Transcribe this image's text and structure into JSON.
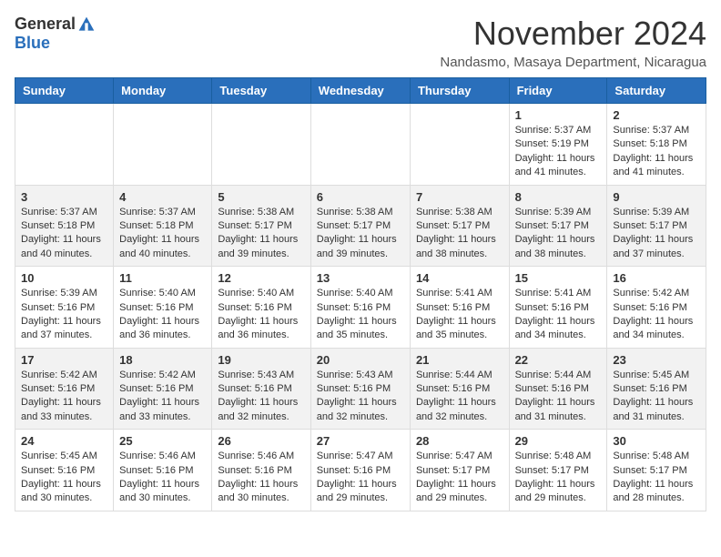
{
  "header": {
    "logo_general": "General",
    "logo_blue": "Blue",
    "month_title": "November 2024",
    "location": "Nandasmo, Masaya Department, Nicaragua"
  },
  "columns": [
    "Sunday",
    "Monday",
    "Tuesday",
    "Wednesday",
    "Thursday",
    "Friday",
    "Saturday"
  ],
  "weeks": [
    [
      {
        "day": "",
        "info": ""
      },
      {
        "day": "",
        "info": ""
      },
      {
        "day": "",
        "info": ""
      },
      {
        "day": "",
        "info": ""
      },
      {
        "day": "",
        "info": ""
      },
      {
        "day": "1",
        "info": "Sunrise: 5:37 AM\nSunset: 5:19 PM\nDaylight: 11 hours\nand 41 minutes."
      },
      {
        "day": "2",
        "info": "Sunrise: 5:37 AM\nSunset: 5:18 PM\nDaylight: 11 hours\nand 41 minutes."
      }
    ],
    [
      {
        "day": "3",
        "info": "Sunrise: 5:37 AM\nSunset: 5:18 PM\nDaylight: 11 hours\nand 40 minutes."
      },
      {
        "day": "4",
        "info": "Sunrise: 5:37 AM\nSunset: 5:18 PM\nDaylight: 11 hours\nand 40 minutes."
      },
      {
        "day": "5",
        "info": "Sunrise: 5:38 AM\nSunset: 5:17 PM\nDaylight: 11 hours\nand 39 minutes."
      },
      {
        "day": "6",
        "info": "Sunrise: 5:38 AM\nSunset: 5:17 PM\nDaylight: 11 hours\nand 39 minutes."
      },
      {
        "day": "7",
        "info": "Sunrise: 5:38 AM\nSunset: 5:17 PM\nDaylight: 11 hours\nand 38 minutes."
      },
      {
        "day": "8",
        "info": "Sunrise: 5:39 AM\nSunset: 5:17 PM\nDaylight: 11 hours\nand 38 minutes."
      },
      {
        "day": "9",
        "info": "Sunrise: 5:39 AM\nSunset: 5:17 PM\nDaylight: 11 hours\nand 37 minutes."
      }
    ],
    [
      {
        "day": "10",
        "info": "Sunrise: 5:39 AM\nSunset: 5:16 PM\nDaylight: 11 hours\nand 37 minutes."
      },
      {
        "day": "11",
        "info": "Sunrise: 5:40 AM\nSunset: 5:16 PM\nDaylight: 11 hours\nand 36 minutes."
      },
      {
        "day": "12",
        "info": "Sunrise: 5:40 AM\nSunset: 5:16 PM\nDaylight: 11 hours\nand 36 minutes."
      },
      {
        "day": "13",
        "info": "Sunrise: 5:40 AM\nSunset: 5:16 PM\nDaylight: 11 hours\nand 35 minutes."
      },
      {
        "day": "14",
        "info": "Sunrise: 5:41 AM\nSunset: 5:16 PM\nDaylight: 11 hours\nand 35 minutes."
      },
      {
        "day": "15",
        "info": "Sunrise: 5:41 AM\nSunset: 5:16 PM\nDaylight: 11 hours\nand 34 minutes."
      },
      {
        "day": "16",
        "info": "Sunrise: 5:42 AM\nSunset: 5:16 PM\nDaylight: 11 hours\nand 34 minutes."
      }
    ],
    [
      {
        "day": "17",
        "info": "Sunrise: 5:42 AM\nSunset: 5:16 PM\nDaylight: 11 hours\nand 33 minutes."
      },
      {
        "day": "18",
        "info": "Sunrise: 5:42 AM\nSunset: 5:16 PM\nDaylight: 11 hours\nand 33 minutes."
      },
      {
        "day": "19",
        "info": "Sunrise: 5:43 AM\nSunset: 5:16 PM\nDaylight: 11 hours\nand 32 minutes."
      },
      {
        "day": "20",
        "info": "Sunrise: 5:43 AM\nSunset: 5:16 PM\nDaylight: 11 hours\nand 32 minutes."
      },
      {
        "day": "21",
        "info": "Sunrise: 5:44 AM\nSunset: 5:16 PM\nDaylight: 11 hours\nand 32 minutes."
      },
      {
        "day": "22",
        "info": "Sunrise: 5:44 AM\nSunset: 5:16 PM\nDaylight: 11 hours\nand 31 minutes."
      },
      {
        "day": "23",
        "info": "Sunrise: 5:45 AM\nSunset: 5:16 PM\nDaylight: 11 hours\nand 31 minutes."
      }
    ],
    [
      {
        "day": "24",
        "info": "Sunrise: 5:45 AM\nSunset: 5:16 PM\nDaylight: 11 hours\nand 30 minutes."
      },
      {
        "day": "25",
        "info": "Sunrise: 5:46 AM\nSunset: 5:16 PM\nDaylight: 11 hours\nand 30 minutes."
      },
      {
        "day": "26",
        "info": "Sunrise: 5:46 AM\nSunset: 5:16 PM\nDaylight: 11 hours\nand 30 minutes."
      },
      {
        "day": "27",
        "info": "Sunrise: 5:47 AM\nSunset: 5:16 PM\nDaylight: 11 hours\nand 29 minutes."
      },
      {
        "day": "28",
        "info": "Sunrise: 5:47 AM\nSunset: 5:17 PM\nDaylight: 11 hours\nand 29 minutes."
      },
      {
        "day": "29",
        "info": "Sunrise: 5:48 AM\nSunset: 5:17 PM\nDaylight: 11 hours\nand 29 minutes."
      },
      {
        "day": "30",
        "info": "Sunrise: 5:48 AM\nSunset: 5:17 PM\nDaylight: 11 hours\nand 28 minutes."
      }
    ]
  ]
}
